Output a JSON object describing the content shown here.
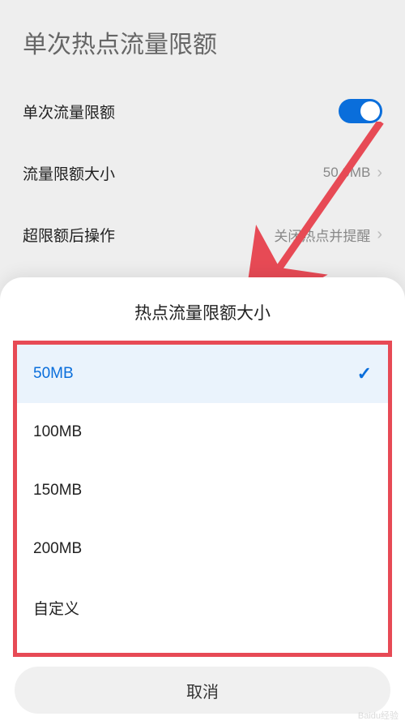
{
  "page_title": "单次热点流量限额",
  "settings": {
    "limit_toggle_label": "单次流量限额",
    "limit_size_label": "流量限额大小",
    "limit_size_value": "50.0MB",
    "over_limit_label": "超限额后操作",
    "over_limit_value": "关闭热点并提醒"
  },
  "sheet": {
    "title": "热点流量限额大小",
    "options": [
      "50MB",
      "100MB",
      "150MB",
      "200MB",
      "自定义"
    ],
    "selected_index": 0,
    "cancel_label": "取消"
  },
  "annotation": {
    "highlight_color": "#e74a55",
    "arrow_color": "#e74a55"
  },
  "watermark": "Baidu经验"
}
